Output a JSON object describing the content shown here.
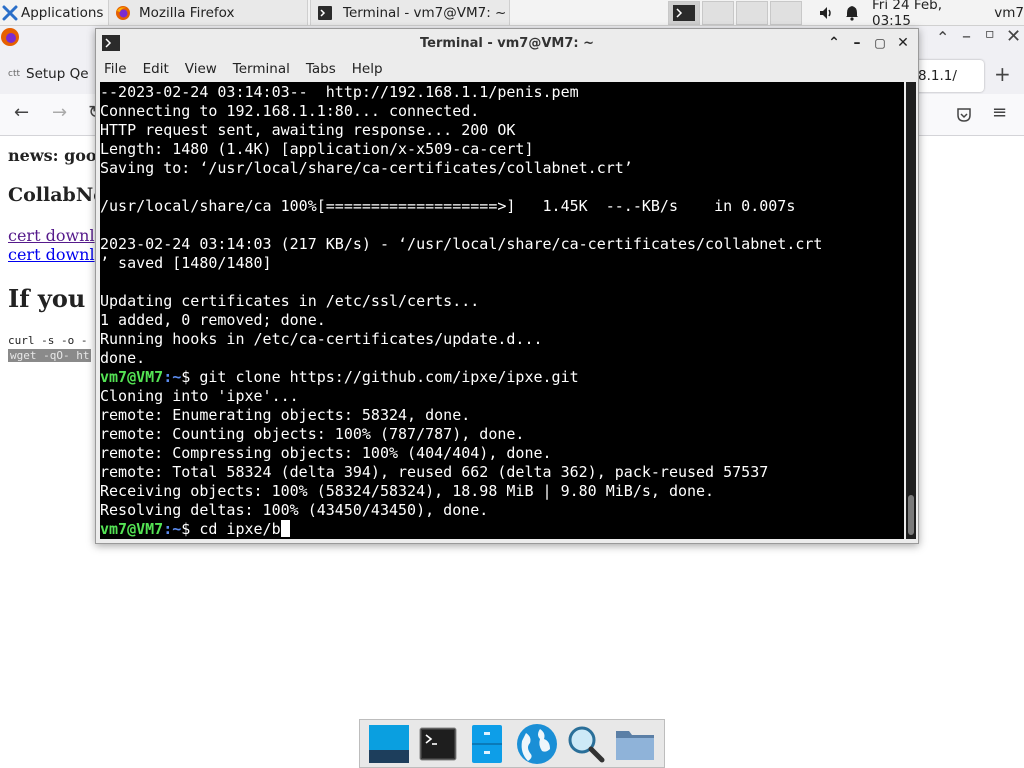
{
  "top_panel": {
    "apps_label": "Applications",
    "firefox_task": "Mozilla Firefox",
    "terminal_task": "Terminal - vm7@VM7: ~",
    "clock": "Fri 24 Feb, 03:15",
    "user": "vm7"
  },
  "firefox": {
    "tab_label": "Setup Qe",
    "url_fragment": "8.1.1/",
    "page": {
      "news": "news: goo",
      "heading": "CollabNe",
      "link1": "cert downl",
      "link2": "cert downl",
      "big_heading": "If you",
      "code1": "curl -s -o -",
      "code2": "wget -qO- ht"
    }
  },
  "terminal": {
    "title": "Terminal - vm7@VM7: ~",
    "menu": [
      "File",
      "Edit",
      "View",
      "Terminal",
      "Tabs",
      "Help"
    ],
    "lines": [
      "--2023-02-24 03:14:03--  http://192.168.1.1/penis.pem",
      "Connecting to 192.168.1.1:80... connected.",
      "HTTP request sent, awaiting response... 200 OK",
      "Length: 1480 (1.4K) [application/x-x509-ca-cert]",
      "Saving to: ‘/usr/local/share/ca-certificates/collabnet.crt’",
      "",
      "/usr/local/share/ca 100%[===================>]   1.45K  --.-KB/s    in 0.007s",
      "",
      "2023-02-24 03:14:03 (217 KB/s) - ‘/usr/local/share/ca-certificates/collabnet.crt",
      "’ saved [1480/1480]",
      "",
      "Updating certificates in /etc/ssl/certs...",
      "1 added, 0 removed; done.",
      "Running hooks in /etc/ca-certificates/update.d...",
      "done."
    ],
    "prompt_user": "vm7@VM7",
    "prompt_path": ":~",
    "prompt_symbol": "$ ",
    "cmd1": "git clone https://github.com/ipxe/ipxe.git",
    "lines2": [
      "Cloning into 'ipxe'...",
      "remote: Enumerating objects: 58324, done.",
      "remote: Counting objects: 100% (787/787), done.",
      "remote: Compressing objects: 100% (404/404), done.",
      "remote: Total 58324 (delta 394), reused 662 (delta 362), pack-reused 57537",
      "Receiving objects: 100% (58324/58324), 18.98 MiB | 9.80 MiB/s, done.",
      "Resolving deltas: 100% (43450/43450), done."
    ],
    "cmd2": "cd ipxe/b"
  },
  "dock": {
    "items": [
      "desktop-icon",
      "terminal-icon",
      "file-cabinet-icon",
      "web-browser-icon",
      "search-icon",
      "folder-icon"
    ]
  },
  "colors": {
    "prompt_user": "#54e354",
    "prompt_path": "#5c8cf0",
    "terminal_bg": "#000000"
  }
}
